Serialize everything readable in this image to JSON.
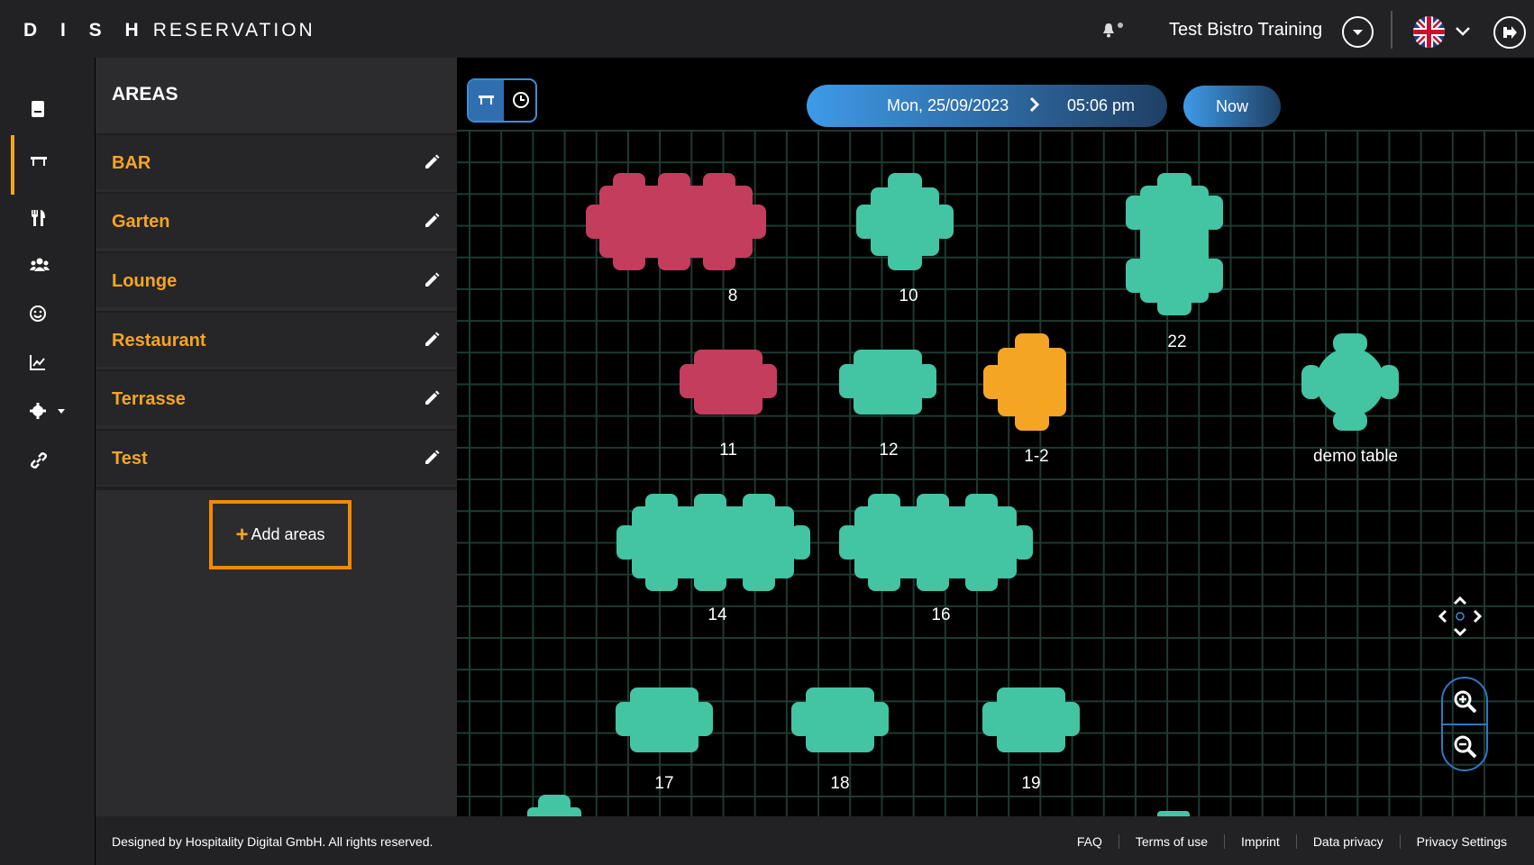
{
  "header": {
    "brand_bold": "D I S H",
    "brand_light": "RESERVATION",
    "restaurant_name": "Test Bistro Training",
    "language_flag": "uk-flag-icon"
  },
  "sidebar": {
    "items": [
      {
        "icon": "book-icon"
      },
      {
        "icon": "table-icon",
        "active": true
      },
      {
        "icon": "cutlery-icon"
      },
      {
        "icon": "guests-icon"
      },
      {
        "icon": "smiley-icon"
      },
      {
        "icon": "chart-icon"
      },
      {
        "icon": "settings-icon"
      },
      {
        "icon": "link-icon"
      }
    ],
    "pause_icon": "pause-icon"
  },
  "areas": {
    "title": "AREAS",
    "items": [
      {
        "label": "BAR"
      },
      {
        "label": "Garten"
      },
      {
        "label": "Lounge"
      },
      {
        "label": "Restaurant"
      },
      {
        "label": "Terrasse"
      },
      {
        "label": "Test"
      }
    ],
    "add_label": "Add areas",
    "add_plus": "+"
  },
  "toolbar": {
    "date": "Mon, 25/09/2023",
    "time": "05:06 pm",
    "now_label": "Now"
  },
  "colors": {
    "free": "#43c4a3",
    "reserved": "#c43d5c",
    "pending": "#f5a524",
    "accent": "#f5a524"
  },
  "tables": [
    {
      "label": "8",
      "status": "reserved"
    },
    {
      "label": "10",
      "status": "free"
    },
    {
      "label": "22",
      "status": "free"
    },
    {
      "label": "11",
      "status": "reserved"
    },
    {
      "label": "12",
      "status": "free"
    },
    {
      "label": "1-2",
      "status": "pending"
    },
    {
      "label": "demo table",
      "status": "free"
    },
    {
      "label": "14",
      "status": "free"
    },
    {
      "label": "16",
      "status": "free"
    },
    {
      "label": "17",
      "status": "free"
    },
    {
      "label": "18",
      "status": "free"
    },
    {
      "label": "19",
      "status": "free"
    }
  ],
  "footer": {
    "copyright": "Designed by Hospitality Digital GmbH. All rights reserved.",
    "links": [
      "FAQ",
      "Terms of use",
      "Imprint",
      "Data privacy",
      "Privacy Settings"
    ]
  }
}
